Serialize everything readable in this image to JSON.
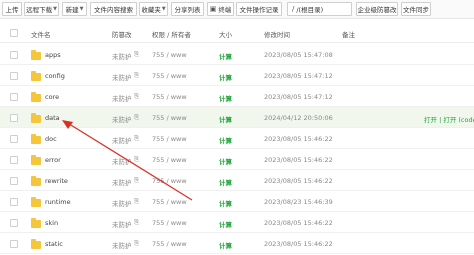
{
  "toolbar": {
    "buttons": [
      {
        "label": "上传",
        "dropdown": false
      },
      {
        "label": "远程下载",
        "dropdown": true
      },
      {
        "label": "新建",
        "dropdown": true
      },
      {
        "label": "文件内容搜索",
        "dropdown": false
      },
      {
        "label": "收藏夹",
        "dropdown": true
      },
      {
        "label": "分享列表",
        "dropdown": false
      },
      {
        "label": "终端",
        "dropdown": false
      },
      {
        "label": "文件操作记录",
        "dropdown": false
      },
      {
        "label": "/(根目录)",
        "dropdown": false
      },
      {
        "label": "企业级防篡改",
        "dropdown": false
      },
      {
        "label": "文件同步",
        "dropdown": false
      }
    ]
  },
  "table": {
    "headers": {
      "name": "文件名",
      "protect": "防篡改",
      "perm": "权限 / 所有者",
      "size": "大小",
      "mtime": "修改时间",
      "note": "备注"
    },
    "rows": [
      {
        "name": "apps",
        "protect": "未防护",
        "perm": "755 / www",
        "size": "计算",
        "mtime": "2023/08/05 15:47:08",
        "ops": ""
      },
      {
        "name": "config",
        "protect": "未防护",
        "perm": "755 / www",
        "size": "计算",
        "mtime": "2023/08/05 15:47:12",
        "ops": ""
      },
      {
        "name": "core",
        "protect": "未防护",
        "perm": "755 / www",
        "size": "计算",
        "mtime": "2023/08/05 15:47:12",
        "ops": ""
      },
      {
        "name": "data",
        "protect": "未防护",
        "perm": "755 / www",
        "size": "计算",
        "mtime": "2024/04/12 20:50:06",
        "ops": "打开 | 打开 (code"
      },
      {
        "name": "doc",
        "protect": "未防护",
        "perm": "755 / www",
        "size": "计算",
        "mtime": "2023/08/05 15:46:22",
        "ops": ""
      },
      {
        "name": "error",
        "protect": "未防护",
        "perm": "755 / www",
        "size": "计算",
        "mtime": "2023/08/05 15:46:22",
        "ops": ""
      },
      {
        "name": "rewrite",
        "protect": "未防护",
        "perm": "755 / www",
        "size": "计算",
        "mtime": "2023/08/05 15:46:22",
        "ops": ""
      },
      {
        "name": "runtime",
        "protect": "未防护",
        "perm": "755 / www",
        "size": "计算",
        "mtime": "2023/08/23 15:46:39",
        "ops": ""
      },
      {
        "name": "skin",
        "protect": "未防护",
        "perm": "755 / www",
        "size": "计算",
        "mtime": "2023/08/05 15:46:22",
        "ops": ""
      },
      {
        "name": "static",
        "protect": "未防护",
        "perm": "755 / www",
        "size": "计算",
        "mtime": "2023/08/05 15:46:22",
        "ops": ""
      }
    ]
  },
  "icons": {
    "folder": "folder-icon",
    "lock": "lock-icon",
    "terminal": "terminal-icon",
    "path": "path-icon",
    "annotation": "red-arrow"
  },
  "colors": {
    "accent": "#20a53a",
    "folder": "#f5c53c",
    "highlight": "#f2f7ee",
    "arrow": "#d93025"
  }
}
